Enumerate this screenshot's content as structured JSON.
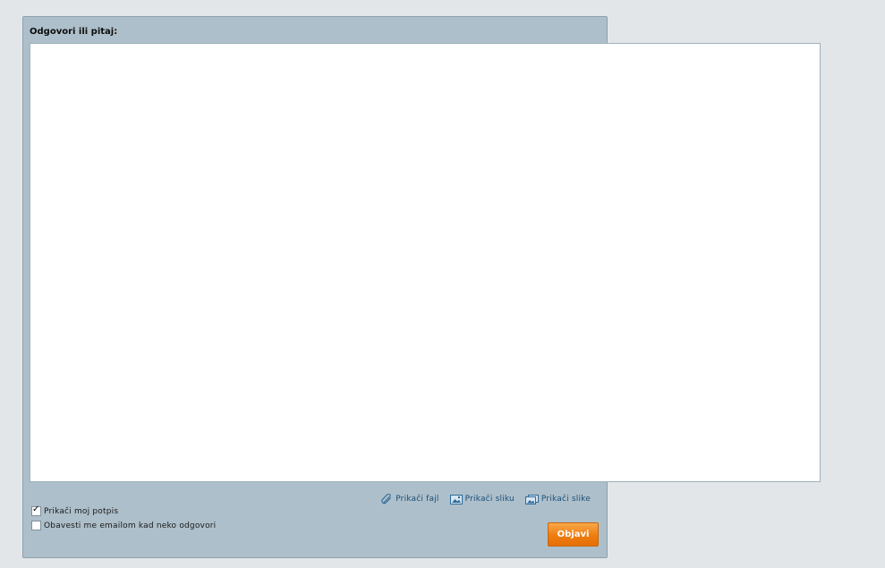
{
  "form": {
    "title": "Odgovori ili pitaj:",
    "textarea_value": ""
  },
  "attachments": {
    "file_label": "Prikači fajl",
    "image_label": "Prikači sliku",
    "images_label": "Prikači slike",
    "file_icon": "paperclip-icon",
    "image_icon": "image-icon",
    "images_icon": "images-icon"
  },
  "options": {
    "signature_label": "Prikači moj potpis",
    "signature_checked": true,
    "notify_label": "Obavesti me emailom kad neko odgovori",
    "notify_checked": false
  },
  "actions": {
    "publish_label": "Objavi"
  },
  "colors": {
    "page_bg": "#e3e6e9",
    "panel_bg": "#adbfca",
    "link": "#1b4f78",
    "button_accent": "#ee7d10"
  }
}
